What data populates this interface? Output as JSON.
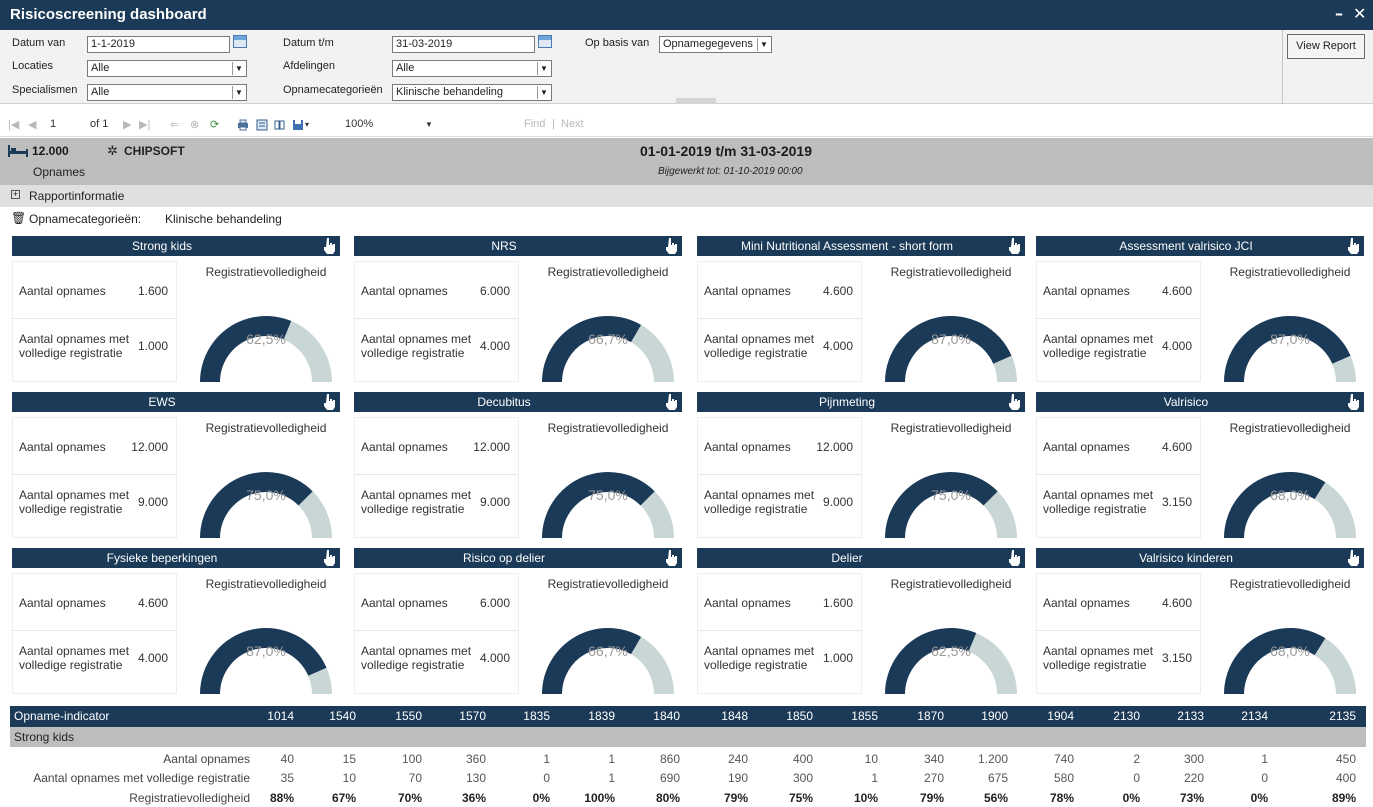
{
  "window": {
    "title": "Risicoscreening dashboard",
    "minimize": "–",
    "close": "✕"
  },
  "params": {
    "datum_van_label": "Datum van",
    "datum_van_value": "1-1-2019",
    "datum_tm_label": "Datum t/m",
    "datum_tm_value": "31-03-2019",
    "op_basis_label": "Op basis van",
    "op_basis_value": "Opnamegegevens",
    "locaties_label": "Locaties",
    "locaties_value": "Alle",
    "afdelingen_label": "Afdelingen",
    "afdelingen_value": "Alle",
    "specialismen_label": "Specialismen",
    "specialismen_value": "Alle",
    "opnamecat_label": "Opnamecategorieën",
    "opnamecat_value": "Klinische behandeling",
    "view_report": "View Report"
  },
  "toolbar": {
    "page": "1",
    "of_pages": "of 1",
    "zoom": "100%",
    "find": "Find",
    "sep": "|",
    "next": "Next"
  },
  "banner": {
    "count": "12.000",
    "count_label": "Opnames",
    "brand": "CHIPSOFT",
    "period": "01-01-2019 t/m 31-03-2019",
    "updated": "Bijgewerkt tot: 01-10-2019 00:00"
  },
  "rapport": {
    "label": "Rapportinformatie"
  },
  "category": {
    "label": "Opnamecategorieën:",
    "value": "Klinische behandeling"
  },
  "cards": [
    {
      "title": "Strong kids",
      "a_label": "Aantal opnames",
      "a_val": "1.600",
      "b_label1": "Aantal opnames met",
      "b_label2": "volledige registratie",
      "b_val": "1.000",
      "g_title": "Registratievolledigheid",
      "pct_text": "62,5%",
      "pct": 0.625
    },
    {
      "title": "NRS",
      "a_label": "Aantal opnames",
      "a_val": "6.000",
      "b_label1": "Aantal opnames met",
      "b_label2": "volledige registratie",
      "b_val": "4.000",
      "g_title": "Registratievolledigheid",
      "pct_text": "66,7%",
      "pct": 0.667
    },
    {
      "title": "Mini Nutritional Assessment - short form",
      "a_label": "Aantal opnames",
      "a_val": "4.600",
      "b_label1": "Aantal opnames met",
      "b_label2": "volledige registratie",
      "b_val": "4.000",
      "g_title": "Registratievolledigheid",
      "pct_text": "87,0%",
      "pct": 0.87
    },
    {
      "title": "Assessment valrisico JCI",
      "a_label": "Aantal opnames",
      "a_val": "4.600",
      "b_label1": "Aantal opnames met",
      "b_label2": "volledige registratie",
      "b_val": "4.000",
      "g_title": "Registratievolledigheid",
      "pct_text": "87,0%",
      "pct": 0.87
    },
    {
      "title": "EWS",
      "a_label": "Aantal opnames",
      "a_val": "12.000",
      "b_label1": "Aantal opnames met",
      "b_label2": "volledige registratie",
      "b_val": "9.000",
      "g_title": "Registratievolledigheid",
      "pct_text": "75,0%",
      "pct": 0.75
    },
    {
      "title": "Decubitus",
      "a_label": "Aantal opnames",
      "a_val": "12.000",
      "b_label1": "Aantal opnames met",
      "b_label2": "volledige registratie",
      "b_val": "9.000",
      "g_title": "Registratievolledigheid",
      "pct_text": "75,0%",
      "pct": 0.75
    },
    {
      "title": "Pijnmeting",
      "a_label": "Aantal opnames",
      "a_val": "12.000",
      "b_label1": "Aantal opnames met",
      "b_label2": "volledige registratie",
      "b_val": "9.000",
      "g_title": "Registratievolledigheid",
      "pct_text": "75,0%",
      "pct": 0.75
    },
    {
      "title": "Valrisico",
      "a_label": "Aantal opnames",
      "a_val": "4.600",
      "b_label1": "Aantal opnames met",
      "b_label2": "volledige registratie",
      "b_val": "3.150",
      "g_title": "Registratievolledigheid",
      "pct_text": "68,0%",
      "pct": 0.68
    },
    {
      "title": "Fysieke beperkingen",
      "a_label": "Aantal opnames",
      "a_val": "4.600",
      "b_label1": "Aantal opnames met",
      "b_label2": "volledige registratie",
      "b_val": "4.000",
      "g_title": "Registratievolledigheid",
      "pct_text": "87,0%",
      "pct": 0.87
    },
    {
      "title": "Risico op delier",
      "a_label": "Aantal opnames",
      "a_val": "6.000",
      "b_label1": "Aantal opnames met",
      "b_label2": "volledige registratie",
      "b_val": "4.000",
      "g_title": "Registratievolledigheid",
      "pct_text": "66,7%",
      "pct": 0.667
    },
    {
      "title": "Delier",
      "a_label": "Aantal opnames",
      "a_val": "1.600",
      "b_label1": "Aantal opnames met",
      "b_label2": "volledige registratie",
      "b_val": "1.000",
      "g_title": "Registratievolledigheid",
      "pct_text": "62,5%",
      "pct": 0.625
    },
    {
      "title": "Valrisico kinderen",
      "a_label": "Aantal opnames",
      "a_val": "4.600",
      "b_label1": "Aantal opnames met",
      "b_label2": "volledige registratie",
      "b_val": "3.150",
      "g_title": "Registratievolledigheid",
      "pct_text": "68,0%",
      "pct": 0.68
    }
  ],
  "table": {
    "header_label": "Opname-indicator",
    "columns": [
      "1014",
      "1540",
      "1550",
      "1570",
      "1835",
      "1839",
      "1840",
      "1848",
      "1850",
      "1855",
      "1870",
      "1900",
      "1904",
      "2130",
      "2133",
      "2134",
      "2135"
    ],
    "section": "Strong kids",
    "rows": [
      {
        "label": "Aantal opnames",
        "values": [
          "40",
          "15",
          "100",
          "360",
          "1",
          "1",
          "860",
          "240",
          "400",
          "10",
          "340",
          "1.200",
          "740",
          "2",
          "300",
          "1",
          "450"
        ]
      },
      {
        "label": "Aantal opnames met volledige registratie",
        "values": [
          "35",
          "10",
          "70",
          "130",
          "0",
          "1",
          "690",
          "190",
          "300",
          "1",
          "270",
          "675",
          "580",
          "0",
          "220",
          "0",
          "400"
        ]
      },
      {
        "label": "Registratievolledigheid",
        "values": [
          "88%",
          "67%",
          "70%",
          "36%",
          "0%",
          "100%",
          "80%",
          "79%",
          "75%",
          "10%",
          "79%",
          "56%",
          "78%",
          "0%",
          "73%",
          "0%",
          "89%"
        ]
      }
    ]
  },
  "colors": {
    "navy": "#1b3a57",
    "gauge_rest": "#c9d6d6",
    "banner": "#bdbdbd"
  }
}
